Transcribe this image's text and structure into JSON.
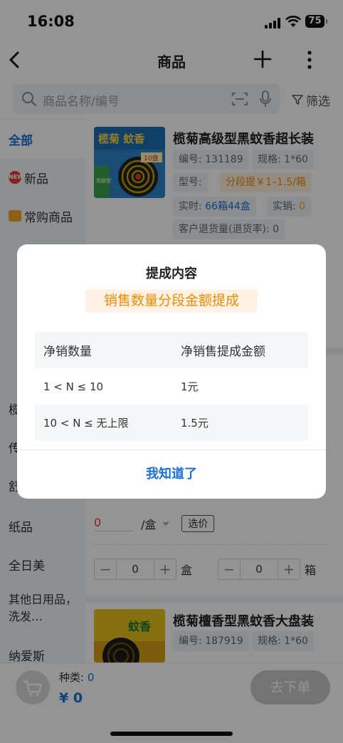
{
  "status": {
    "time": "16:08",
    "battery": "75"
  },
  "nav": {
    "title": "商品"
  },
  "search": {
    "placeholder": "商品名称/编号",
    "filter_label": "筛选"
  },
  "sidebar": {
    "items": [
      {
        "label": "全部"
      },
      {
        "label": "新品",
        "icon_text": "NEW"
      },
      {
        "label": "常购商品"
      },
      {
        "label": "榄"
      },
      {
        "label": "传"
      },
      {
        "label": "舒"
      },
      {
        "label": "纸品"
      },
      {
        "label": "全日美"
      },
      {
        "label": "其他日用品，洗发…"
      },
      {
        "label": "纳爱斯"
      }
    ]
  },
  "products": [
    {
      "name": "榄菊高级型黑蚊香超长装",
      "code": "编号: 131189",
      "spec": "规格: 1*60",
      "model_label": "型号:",
      "commission_tag": "分段提￥1–1.5/箱",
      "realtime_label": "实时:",
      "realtime_value": "66箱44盒",
      "sales_label": "实销:",
      "sales_value": "0",
      "returns": "客户退货量(退货率): 0",
      "img_brand": "榄菊 蚊香",
      "img_tag": "10盘",
      "img_side": "高级型"
    },
    {
      "name": "榄菊檀香型黑蚊香大盘装",
      "code": "编号: 187919",
      "spec": "规格: 1*60",
      "img_brand": "蚊香"
    }
  ],
  "order_row": {
    "price": "0",
    "unit": "/盒",
    "select_price": "选价",
    "stepper_box_value": "0",
    "stepper_box_unit": "盒",
    "stepper_case_value": "0",
    "stepper_case_unit": "箱"
  },
  "bottom": {
    "kinds_label": "种类:",
    "kinds_value": "0",
    "amount": "¥ 0",
    "order_button": "去下单"
  },
  "modal": {
    "title": "提成内容",
    "badge": "销售数量分段金额提成",
    "table": {
      "headers": [
        "净销数量",
        "净销售提成金额"
      ],
      "rows": [
        [
          "1 < N ≤ 10",
          "1元"
        ],
        [
          "10 < N ≤ 无上限",
          "1.5元"
        ]
      ]
    },
    "confirm": "我知道了"
  },
  "colors": {
    "accent": "#1b6fd8",
    "orange": "#f08c00"
  }
}
